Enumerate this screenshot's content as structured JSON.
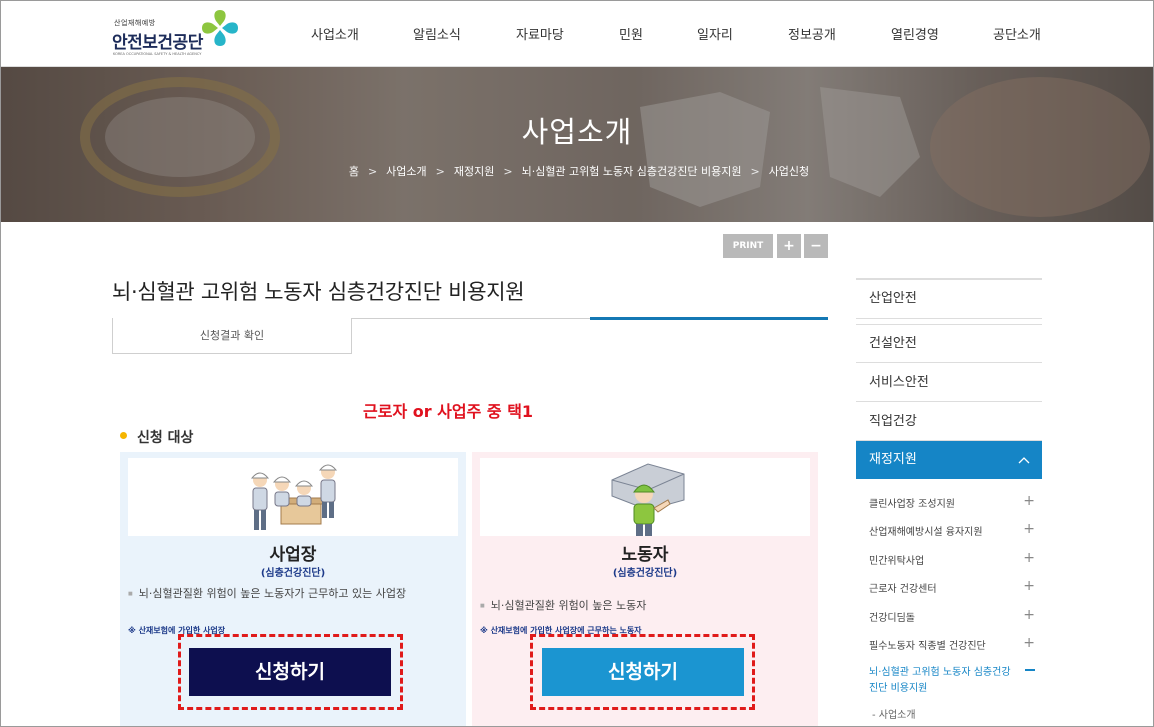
{
  "header": {
    "logo_small": "산업재해예방",
    "logo_name": "안전보건공단",
    "logo_eng": "KOREA OCCUPATIONAL SAFETY & HEALTH AGENCY",
    "nav": [
      "사업소개",
      "알림소식",
      "자료마당",
      "민원",
      "일자리",
      "정보공개",
      "열린경영",
      "공단소개"
    ]
  },
  "hero": {
    "title": "사업소개",
    "breadcrumbs": [
      "홈",
      "사업소개",
      "재정지원",
      "뇌·심혈관 고위험 노동자 심층건강진단 비용지원",
      "사업신청"
    ],
    "separator": ">"
  },
  "tools": {
    "print": "PRINT",
    "zoom_in": "+",
    "zoom_out": "−"
  },
  "main": {
    "title": "뇌·심혈관 고위험 노동자 심층건강진단 비용지원",
    "tab_label": "신청결과 확인",
    "annotation": "근로자 or 사업주 중 택1",
    "section_title": "신청 대상",
    "cards": [
      {
        "title": "사업장",
        "subtitle": "(심층건강진단)",
        "bullet": "뇌·심혈관질환 위험이 높은 노동자가 근무하고 있는 사업장",
        "note": "※ 산재보험에 가입한 사업장",
        "button": "신청하기"
      },
      {
        "title": "노동자",
        "subtitle": "(심층건강진단)",
        "bullet": "뇌·심혈관질환 위험이 높은 노동자",
        "note": "※ 산재보험에 가입한 사업장에 근무하는 노동자",
        "button": "신청하기"
      }
    ]
  },
  "sidebar": {
    "items": [
      "산업안전",
      "건설안전",
      "서비스안전",
      "직업건강"
    ],
    "active": "재정지원",
    "sub_items": [
      "클린사업장 조성지원",
      "산업재해예방시설 융자지원",
      "민간위탁사업",
      "근로자 건강센터",
      "건강디딤돌",
      "필수노동자 직종별 건강진단"
    ],
    "sub_active": "뇌·심혈관 고위험 노동자 심층건강진단 비용지원",
    "sub_sub": "- 사업소개"
  },
  "colors": {
    "primary": "#1585c6",
    "navy": "#0d0f4f",
    "accent_red": "#e0111e",
    "dot": "#f5b500"
  }
}
